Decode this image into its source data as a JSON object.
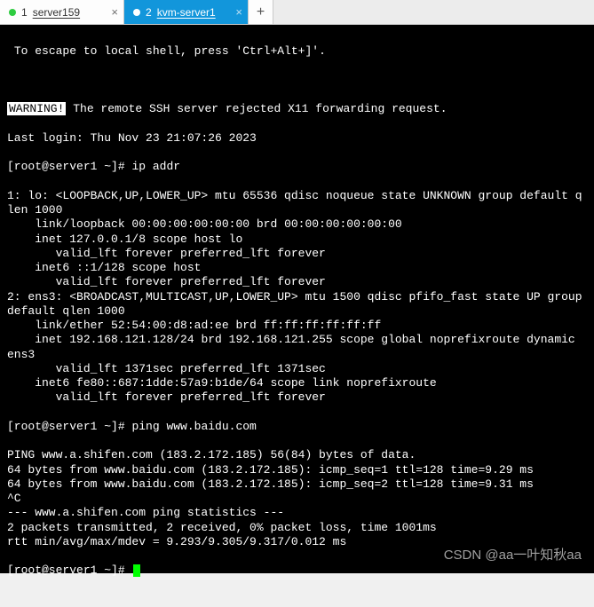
{
  "tabs": [
    {
      "index": "1",
      "label": "server159",
      "active": false
    },
    {
      "index": "2",
      "label": "kvm-server1",
      "active": true
    }
  ],
  "newtab_label": "+",
  "terminal": {
    "escape_hint": " To escape to local shell, press 'Ctrl+Alt+]'.",
    "warning_label": "WARNING!",
    "warning_msg": " The remote SSH server rejected X11 forwarding request.",
    "last_login": "Last login: Thu Nov 23 21:07:26 2023",
    "prompt1": "[root@server1 ~]# ",
    "cmd1": "ip addr",
    "ip_output": "1: lo: <LOOPBACK,UP,LOWER_UP> mtu 65536 qdisc noqueue state UNKNOWN group default qlen 1000\n    link/loopback 00:00:00:00:00:00 brd 00:00:00:00:00:00\n    inet 127.0.0.1/8 scope host lo\n       valid_lft forever preferred_lft forever\n    inet6 ::1/128 scope host\n       valid_lft forever preferred_lft forever\n2: ens3: <BROADCAST,MULTICAST,UP,LOWER_UP> mtu 1500 qdisc pfifo_fast state UP group default qlen 1000\n    link/ether 52:54:00:d8:ad:ee brd ff:ff:ff:ff:ff:ff\n    inet 192.168.121.128/24 brd 192.168.121.255 scope global noprefixroute dynamic ens3\n       valid_lft 1371sec preferred_lft 1371sec\n    inet6 fe80::687:1dde:57a9:b1de/64 scope link noprefixroute\n       valid_lft forever preferred_lft forever",
    "prompt2": "[root@server1 ~]# ",
    "cmd2": "ping www.baidu.com",
    "ping_output": "PING www.a.shifen.com (183.2.172.185) 56(84) bytes of data.\n64 bytes from www.baidu.com (183.2.172.185): icmp_seq=1 ttl=128 time=9.29 ms\n64 bytes from www.baidu.com (183.2.172.185): icmp_seq=2 ttl=128 time=9.31 ms\n^C\n--- www.a.shifen.com ping statistics ---\n2 packets transmitted, 2 received, 0% packet loss, time 1001ms\nrtt min/avg/max/mdev = 9.293/9.305/9.317/0.012 ms",
    "prompt3": "[root@server1 ~]# "
  },
  "watermark": "CSDN @aa一叶知秋aa"
}
